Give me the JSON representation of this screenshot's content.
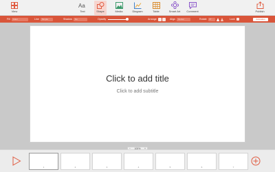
{
  "toolbar": {
    "view": "View",
    "text": "Text",
    "shape": "Shape",
    "media": "Media",
    "diagram": "Diagram",
    "table": "Table",
    "smartart": "Smart Art",
    "comment": "Comment",
    "publish": "Publish"
  },
  "formatbar": {
    "fill": "Fill",
    "fill_value": "Color",
    "line": "Line",
    "line_value": "Simple",
    "shadow": "Shadow",
    "shadow_value": "No",
    "opacity": "Opacity",
    "arrange": "Arrange",
    "align": "Align",
    "align_value": "Center",
    "rotate": "Rotate",
    "rotate_value": "0°",
    "lock": "Lock",
    "animation": "Animation"
  },
  "slide": {
    "title": "Click to add title",
    "subtitle": "Click to add subtitle"
  },
  "zoom": {
    "minus": "−",
    "value": "100%",
    "plus": "+"
  },
  "thumbnails": [
    "1",
    "2",
    "3",
    "4",
    "5",
    "6",
    "7"
  ],
  "colors": {
    "accent": "#d9553a",
    "toolbar_bg": "#f1f1f1",
    "canvas_bg": "#c9c9c9"
  }
}
